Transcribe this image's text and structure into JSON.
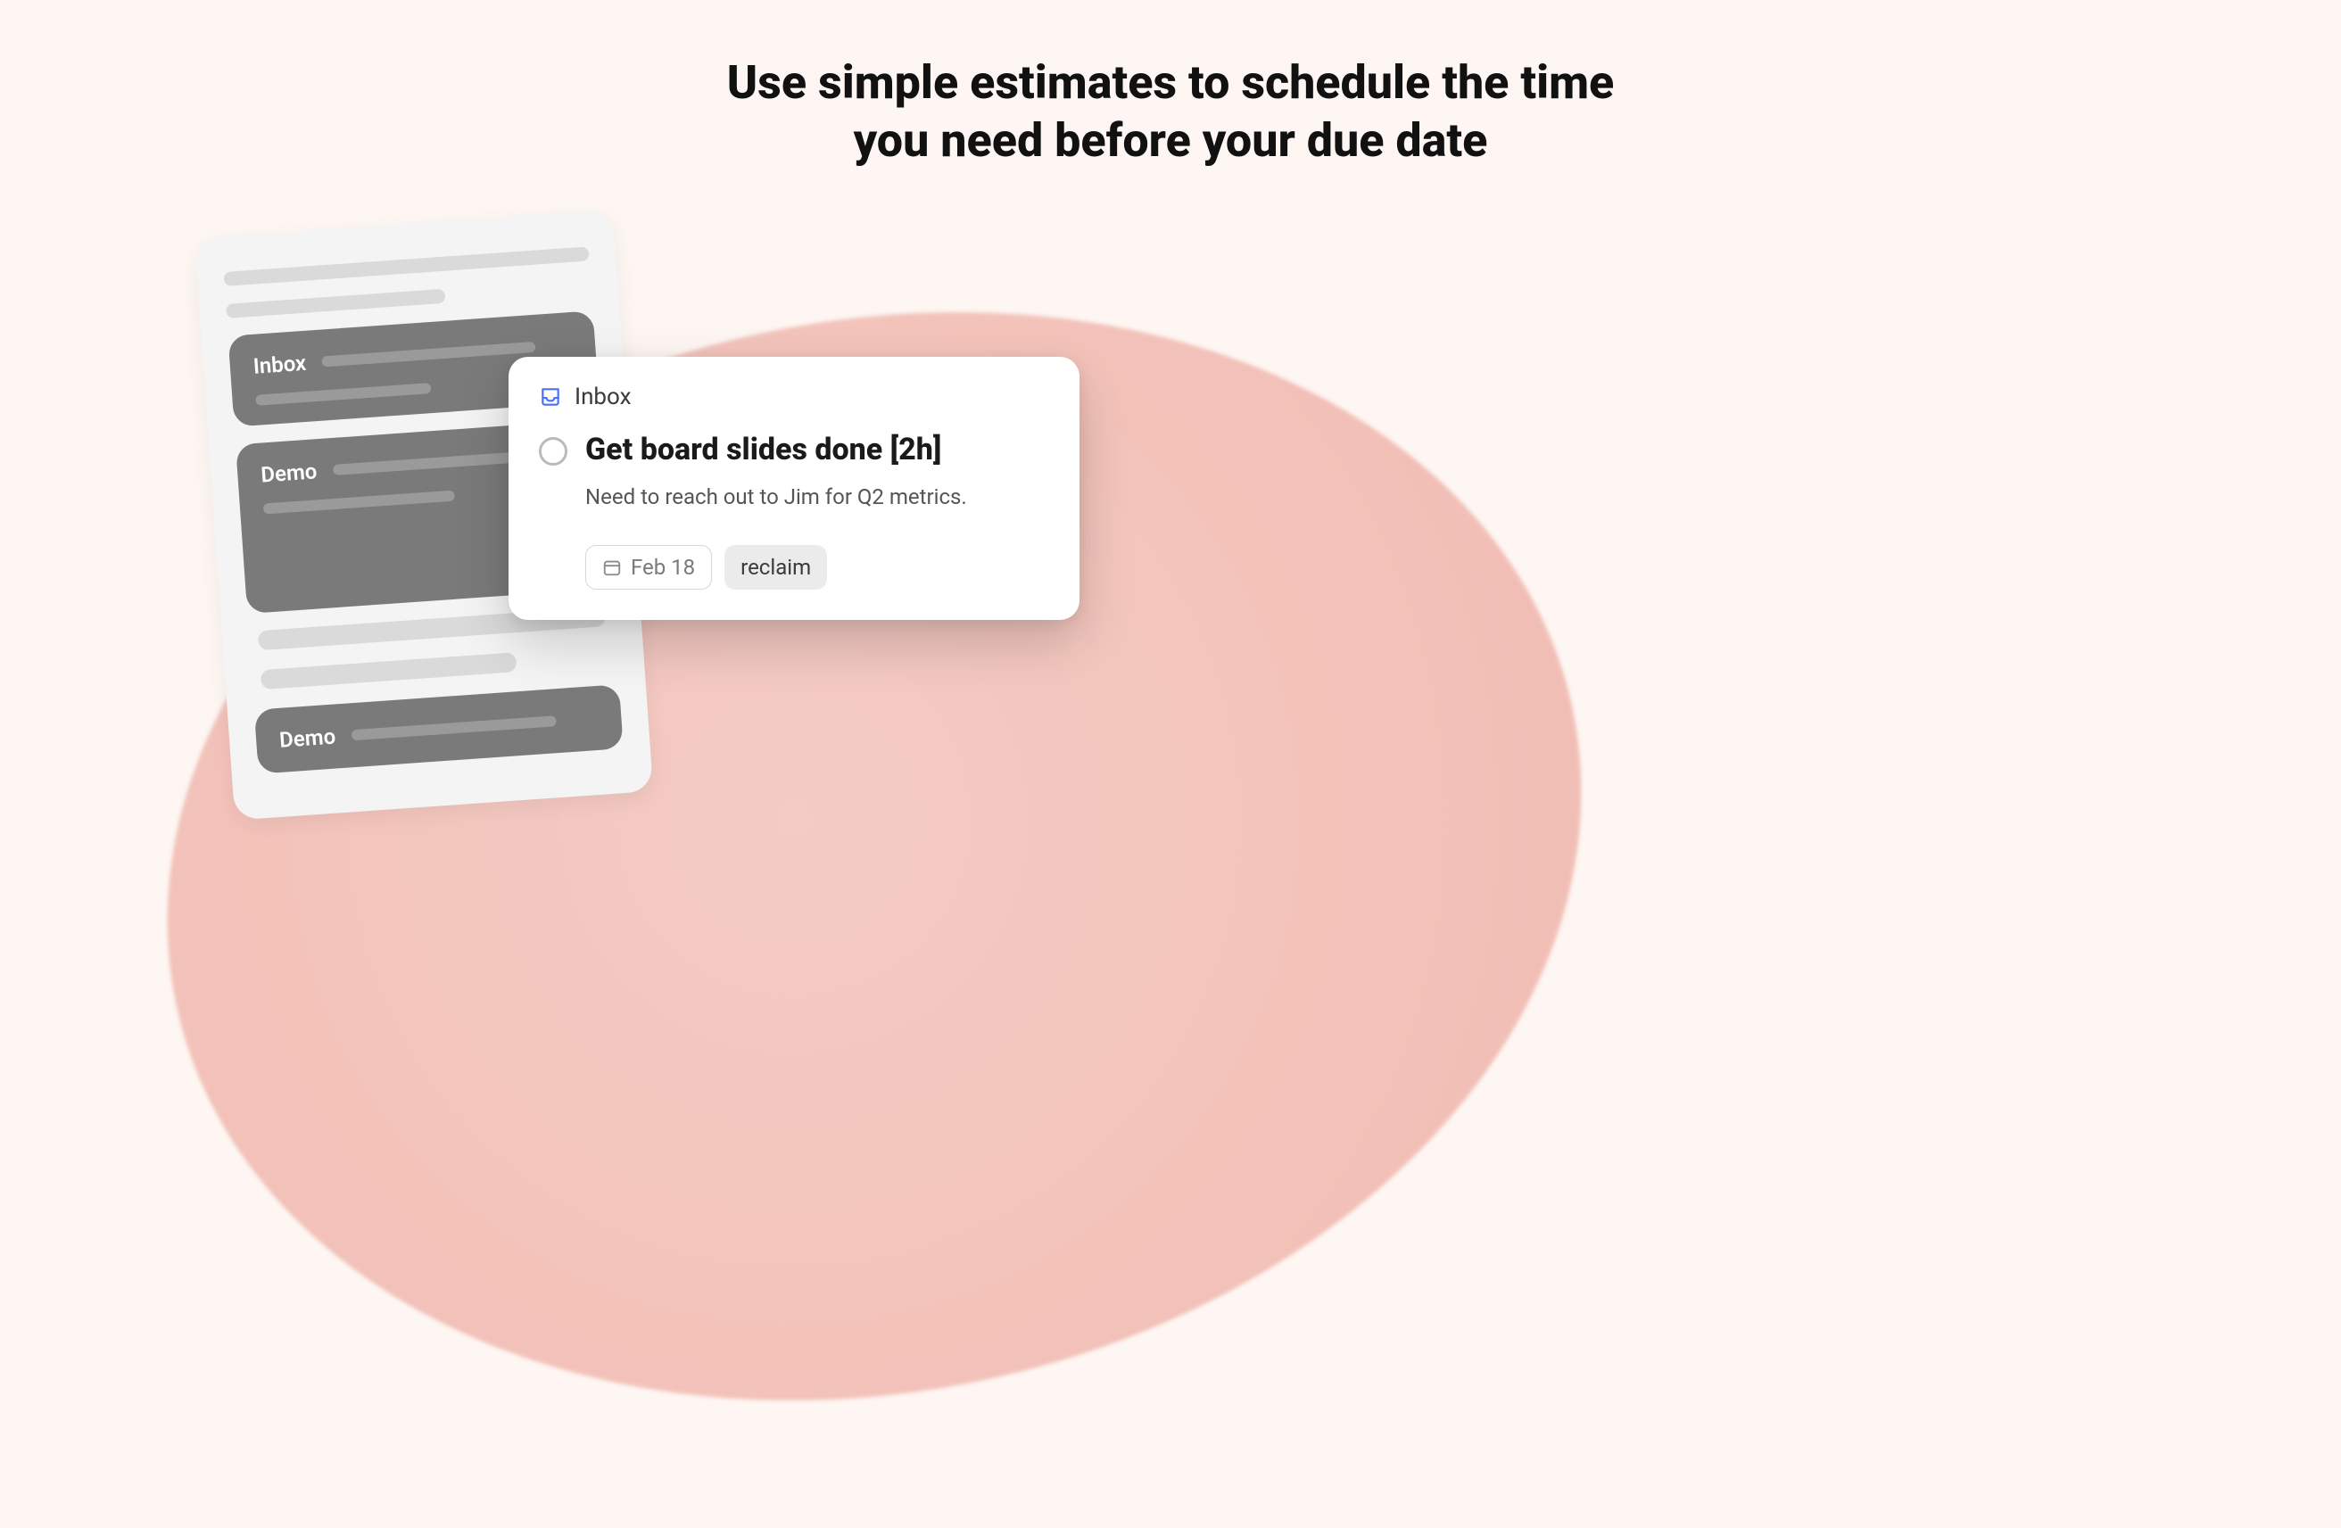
{
  "headline": {
    "line1": "Use simple estimates to schedule the time",
    "line2": "you need before your due date"
  },
  "back_card": {
    "sections": [
      {
        "label": "Inbox"
      },
      {
        "label": "Demo"
      },
      {
        "label": "Demo"
      }
    ]
  },
  "task_card": {
    "section_label": "Inbox",
    "title": "Get board slides done [2h]",
    "description": "Need to reach out to Jim for Q2 metrics.",
    "due_date": "Feb 18",
    "tag": "reclaim"
  }
}
